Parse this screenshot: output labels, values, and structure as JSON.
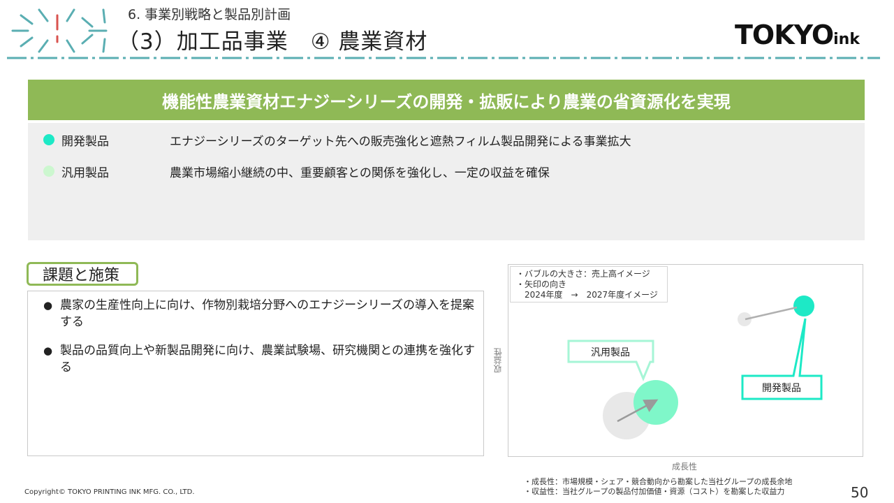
{
  "header": {
    "subtitle": "6. 事業別戦略と製品別計画",
    "title": "（3）加工品事業　④ 農業資材",
    "brand_main": "TOKYO",
    "brand_sub": "ink"
  },
  "banner": {
    "text": "機能性農業資材エナジーシリーズの開発・拡販により農業の省資源化を実現"
  },
  "products": [
    {
      "name": "開発製品",
      "desc": "エナジーシリーズのターゲット先への販売強化と遮熱フィルム製品開発による事業拡大",
      "color": "#1de9c6"
    },
    {
      "name": "汎用製品",
      "desc": "農業市場縮小継続の中、重要顧客との関係を強化し、一定の収益を確保",
      "color": "#ccf7cf"
    }
  ],
  "issues": {
    "heading": "課題と施策",
    "items": [
      "農家の生産性向上に向け、作物別栽培分野へのエナジーシリーズの導入を提案する",
      "製品の品質向上や新製品開発に向け、農業試験場、研究機関との連携を強化する"
    ]
  },
  "chart_data": {
    "type": "scatter",
    "title": "",
    "xlabel": "成長性",
    "ylabel": "収益性",
    "legend_note": "・バブルの大きさ：売上高イメージ\n・矢印の向き\n　2024年度　→　2027年度イメージ",
    "series": [
      {
        "name": "汎用製品",
        "from": "2024年度",
        "to": "2027年度",
        "color_from": "#e8e8e8",
        "color_to": "#7ff7c9"
      },
      {
        "name": "開発製品",
        "from": "2024年度",
        "to": "2027年度",
        "color_from": "#e8e8e8",
        "color_to": "#1de9c6"
      }
    ],
    "notes": [
      "・成長性：市場規模・シェア・競合動向から勘案した当社グループの成長余地",
      "・収益性：当社グループの製品付加価値・資源（コスト）を勘案した収益力"
    ]
  },
  "footer": {
    "copyright": "Copyright© TOKYO PRINTING INK MFG. CO., LTD.",
    "page": "50"
  }
}
